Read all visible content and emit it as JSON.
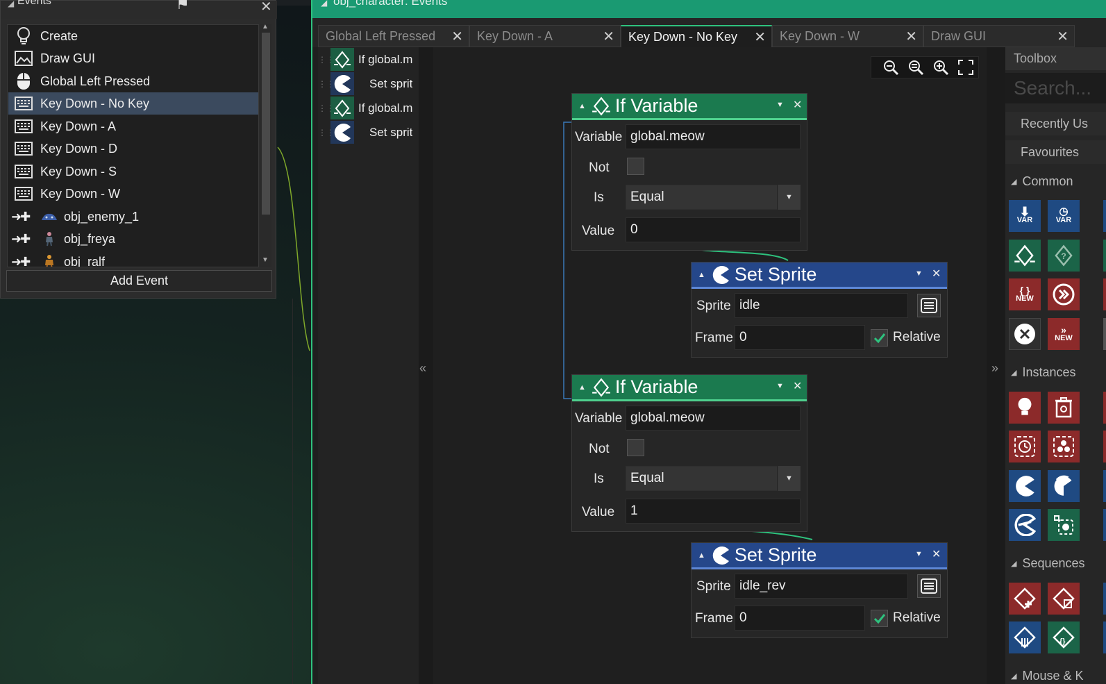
{
  "events_panel": {
    "title": "Events",
    "items": [
      {
        "label": "Create",
        "icon": "lightbulb-icon"
      },
      {
        "label": "Draw GUI",
        "icon": "image-icon"
      },
      {
        "label": "Global Left Pressed",
        "icon": "mouse-icon"
      },
      {
        "label": "Key Down - No Key",
        "icon": "keyboard-icon",
        "selected": true
      },
      {
        "label": "Key Down - A",
        "icon": "keyboard-icon"
      },
      {
        "label": "Key Down - D",
        "icon": "keyboard-icon"
      },
      {
        "label": "Key Down - S",
        "icon": "keyboard-icon"
      },
      {
        "label": "Key Down - W",
        "icon": "keyboard-icon"
      },
      {
        "label": "obj_enemy_1",
        "icon": "collision-icon"
      },
      {
        "label": "obj_freya",
        "icon": "collision-icon"
      },
      {
        "label": "obj_ralf",
        "icon": "collision-icon"
      }
    ],
    "add_event_label": "Add Event"
  },
  "editor": {
    "title": "obj_character: Events",
    "tabs": [
      {
        "label": "Global Left Pressed",
        "active": false
      },
      {
        "label": "Key Down - A",
        "active": false
      },
      {
        "label": "Key Down - No Key",
        "active": true
      },
      {
        "label": "Key Down - W",
        "active": false
      },
      {
        "label": "Draw GUI",
        "active": false
      }
    ],
    "action_list": [
      {
        "label": "If global.m",
        "type": "if-variable"
      },
      {
        "label": "Set sprit",
        "type": "set-sprite"
      },
      {
        "label": "If global.m",
        "type": "if-variable"
      },
      {
        "label": "Set sprit",
        "type": "set-sprite"
      }
    ],
    "collapse_left": "«",
    "collapse_right": "»"
  },
  "nodes": {
    "if1": {
      "title": "If Variable",
      "variable_label": "Variable",
      "variable": "global.meow",
      "not_label": "Not",
      "is_label": "Is",
      "is": "Equal",
      "value_label": "Value",
      "value": "0"
    },
    "set1": {
      "title": "Set Sprite",
      "sprite_label": "Sprite",
      "sprite": "idle",
      "frame_label": "Frame",
      "frame": "0",
      "relative_label": "Relative"
    },
    "if2": {
      "title": "If Variable",
      "variable_label": "Variable",
      "variable": "global.meow",
      "not_label": "Not",
      "is_label": "Is",
      "is": "Equal",
      "value_label": "Value",
      "value": "1"
    },
    "set2": {
      "title": "Set Sprite",
      "sprite_label": "Sprite",
      "sprite": "idle_rev",
      "frame_label": "Frame",
      "frame": "0",
      "relative_label": "Relative"
    }
  },
  "toolbox": {
    "title": "Toolbox",
    "search_placeholder": "Search...",
    "recently_used": "Recently Us",
    "favourites": "Favourites",
    "sections": [
      "Common",
      "Instances",
      "Sequences",
      "Mouse & K"
    ],
    "common_labels": [
      "VAR",
      "VAR",
      "NEW",
      "NEW"
    ]
  },
  "colors": {
    "accent": "#2ec27e",
    "if_header": "#1b7a4f",
    "set_header": "#25478a",
    "selected": "#3b4a5e"
  }
}
